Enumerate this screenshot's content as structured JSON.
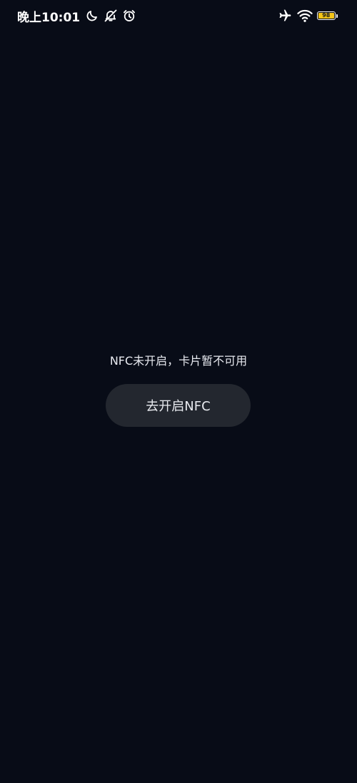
{
  "status_bar": {
    "time": "晚上10:01",
    "battery_level": "98",
    "battery_fraction": 0.98,
    "icons": [
      "moon-icon",
      "mute-icon",
      "alarm-icon",
      "airplane-icon",
      "wifi-icon",
      "battery-icon"
    ],
    "battery_color": "#f5c518"
  },
  "main": {
    "message": "NFC未开启，卡片暂不可用",
    "enable_button_label": "去开启NFC"
  },
  "colors": {
    "background": "#080c17",
    "button_background": "#23272f",
    "text": "#e8eaf0"
  }
}
